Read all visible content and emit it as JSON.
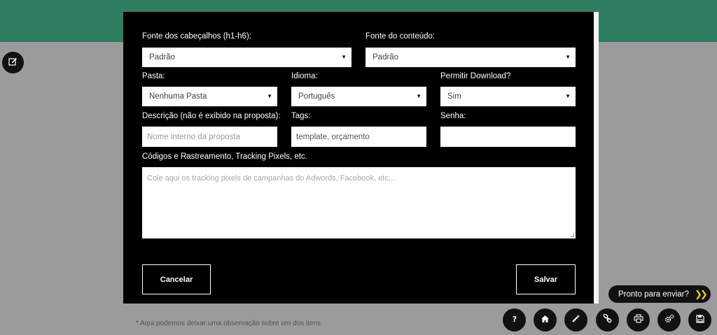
{
  "background": {
    "footnote": "* Aqui podemos deixar uma observação sobre um dos itens",
    "send_pill": "Pronto para enviar?",
    "toolbar_icons": [
      "help-icon",
      "home-icon",
      "magic-wand-icon",
      "link-icon",
      "print-icon",
      "settings-icon",
      "save-icon"
    ]
  },
  "modal": {
    "heading_font": {
      "label": "Fonte dos cabeçalhos (h1-h6):",
      "value": "Padrão"
    },
    "content_font": {
      "label": "Fonte do conteúdo:",
      "value": "Padrão"
    },
    "folder": {
      "label": "Pasta:",
      "value": "Nenhuma Pasta"
    },
    "language": {
      "label": "Idioma:",
      "value": "Português"
    },
    "download": {
      "label": "Permitir Download?",
      "value": "Sim"
    },
    "description": {
      "label": "Descrição (não é exibido na proposta):",
      "placeholder": "Nome interno da proposta"
    },
    "tags": {
      "label": "Tags:",
      "value": "template, orçamento"
    },
    "password": {
      "label": "Senha:",
      "value": ""
    },
    "tracking": {
      "label": "Códigos e Rastreamento, Tracking Pixels, etc.",
      "placeholder": "Cole aqui os tracking pixels de campanhas do Adwords, Facebook, etc..."
    },
    "cancel_label": "Cancelar",
    "save_label": "Salvar"
  },
  "colors": {
    "header_green": "#2d7d5e",
    "overlay": "#9b9b9b",
    "modal_bg": "#000000",
    "accent_yellow": "#e2d31c"
  }
}
